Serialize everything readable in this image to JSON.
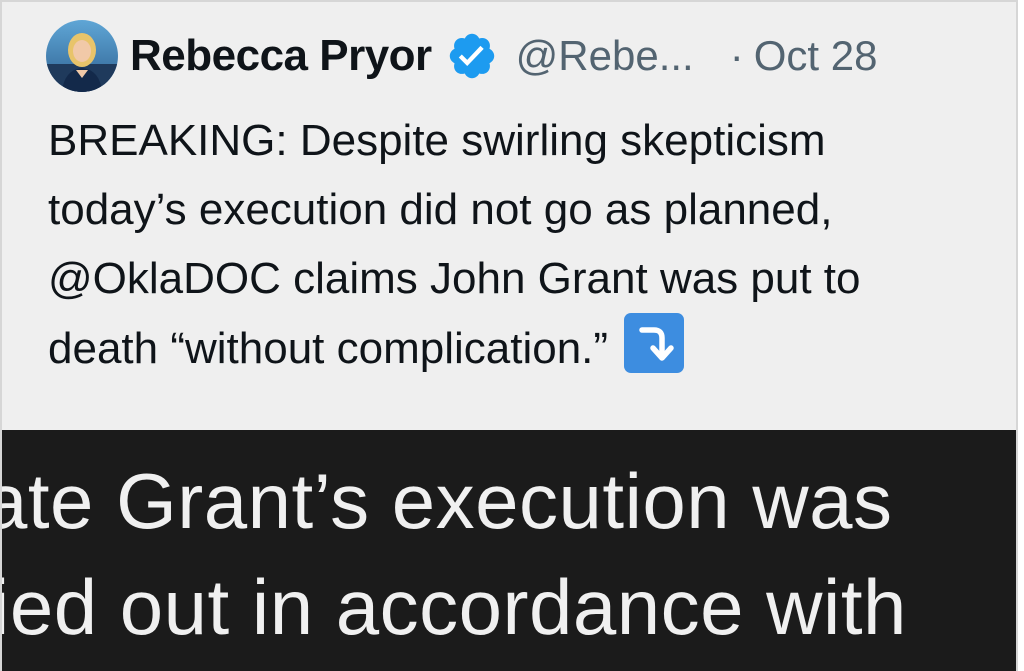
{
  "tweet": {
    "display_name": "Rebecca Pryor",
    "handle": "@Rebe...",
    "separator": "·",
    "date": "Oct 28",
    "text_lines": [
      "BREAKING: Despite swirling skepticism",
      "today’s execution did not go as planned,",
      "@OklaDOC claims John Grant was put to",
      "death “without complication.”"
    ],
    "verified": true,
    "verified_color": "#1d9bf0",
    "emoji": "right-arrow-curving-down-icon",
    "emoji_color": "#3d8de0"
  },
  "media": {
    "lines": [
      "ate Grant’s execution was",
      "ied out in accordance with"
    ]
  }
}
